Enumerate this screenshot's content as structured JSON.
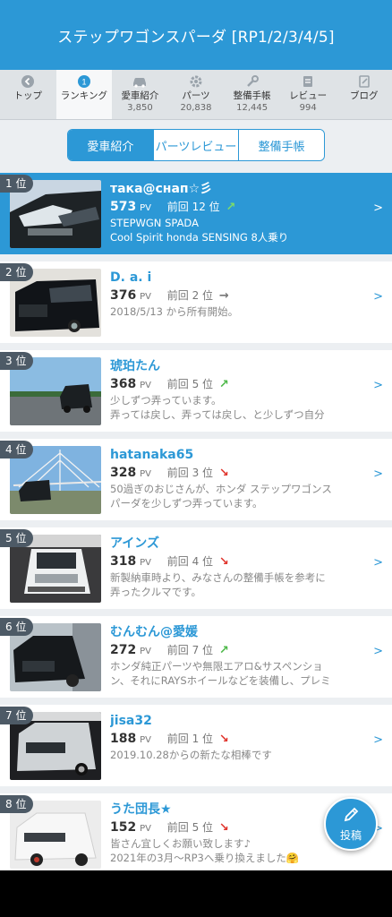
{
  "header": {
    "title": "ステップワゴンスパーダ [RP1/2/3/4/5]"
  },
  "tabs": [
    {
      "label": "トップ",
      "count": "",
      "icon": "back-arrow-icon"
    },
    {
      "label": "ランキング",
      "count": "",
      "icon": "rank-medal-icon"
    },
    {
      "label": "愛車紹介",
      "count": "3,850",
      "icon": "car-icon"
    },
    {
      "label": "パーツ",
      "count": "20,838",
      "icon": "gear-icon"
    },
    {
      "label": "整備手帳",
      "count": "12,445",
      "icon": "wrench-icon"
    },
    {
      "label": "レビュー",
      "count": "994",
      "icon": "review-icon"
    },
    {
      "label": "ブログ",
      "count": "",
      "icon": "blog-icon"
    }
  ],
  "segments": [
    "愛車紹介",
    "パーツレビュー",
    "整備手帳"
  ],
  "ranking": [
    {
      "rank": "1 位",
      "name": "така@снап☆彡",
      "pv": "573",
      "pv_unit": "PV",
      "prev": "前回 12 位",
      "trend": "up",
      "desc1": "STEPWGN SPADA",
      "desc2": "Cool Spirit honda SENSING  8人乗り"
    },
    {
      "rank": "2 位",
      "name": "D. a. i",
      "pv": "376",
      "pv_unit": "PV",
      "prev": "前回 2 位",
      "trend": "flat",
      "desc1": "2018/5/13 から所有開始。",
      "desc2": ""
    },
    {
      "rank": "3 位",
      "name": "琥珀たん",
      "pv": "368",
      "pv_unit": "PV",
      "prev": "前回 5 位",
      "trend": "up",
      "desc1": "少しずつ弄っています。",
      "desc2": "弄っては戻し、弄っては戻し、と少しずつ自分"
    },
    {
      "rank": "4 位",
      "name": "hatanaka65",
      "pv": "328",
      "pv_unit": "PV",
      "prev": "前回 3 位",
      "trend": "down",
      "desc1": "50過ぎのおじさんが、ホンダ ステップワゴンス",
      "desc2": "パーダを少しずつ弄っています。"
    },
    {
      "rank": "5 位",
      "name": "アインズ",
      "pv": "318",
      "pv_unit": "PV",
      "prev": "前回 4 位",
      "trend": "down",
      "desc1": "新製納車時より、みなさんの整備手帳を参考に",
      "desc2": "弄ったクルマです。"
    },
    {
      "rank": "6 位",
      "name": "むんむん@愛媛",
      "pv": "272",
      "pv_unit": "PV",
      "prev": "前回 7 位",
      "trend": "up",
      "desc1": "ホンダ純正パーツや無限エアロ&サスペンショ",
      "desc2": "ン、それにRAYSホイールなどを装備し、プレミ"
    },
    {
      "rank": "7 位",
      "name": "jisa32",
      "pv": "188",
      "pv_unit": "PV",
      "prev": "前回 1 位",
      "trend": "down",
      "desc1": "2019.10.28からの新たな相棒です",
      "desc2": ""
    },
    {
      "rank": "8 位",
      "name": "うた団長★",
      "pv": "152",
      "pv_unit": "PV",
      "prev": "前回 5 位",
      "trend": "down",
      "desc1": "皆さん宜しくお願い致します♪",
      "desc2": "2021年の3月～RP3へ乗り換えました🤗"
    }
  ],
  "fab": {
    "label": "投稿"
  },
  "colors": {
    "accent": "#2c98d6",
    "up": "#4cb848",
    "down": "#e0332b"
  }
}
